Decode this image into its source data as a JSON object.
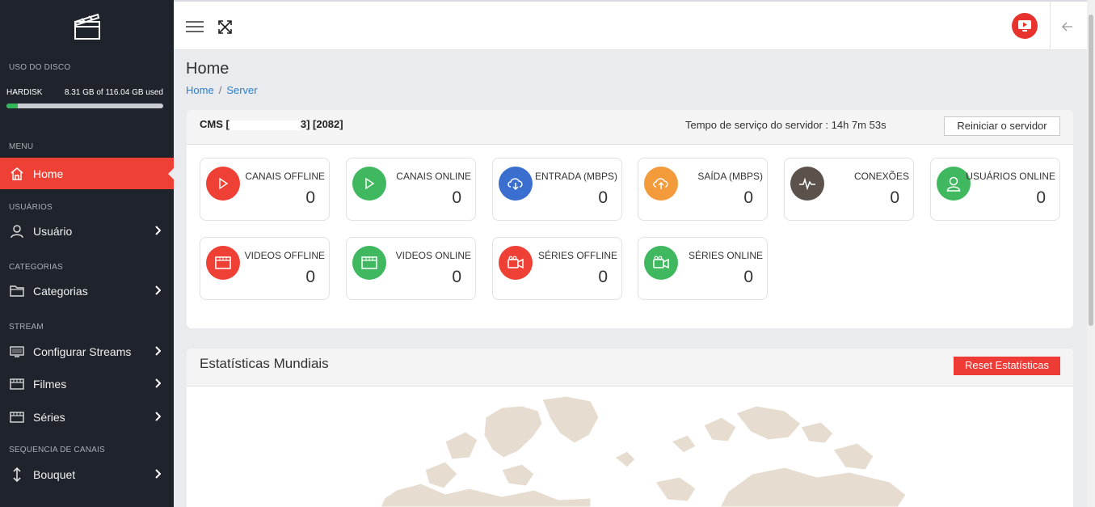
{
  "sidebar": {
    "disk_section": "USO DO DISCO",
    "disk_label": "HARDISK",
    "disk_used": "8.31 GB of 116.04 GB used",
    "disk_fraction": 0.0716,
    "menu_section": "MENU",
    "home": "Home",
    "users_section": "USUÁRIOS",
    "user": "Usuário",
    "categories_section": "CATEGORIAS",
    "categories": "Categorias",
    "stream_section": "STREAM",
    "streams": "Configurar Streams",
    "films": "Filmes",
    "series": "Séries",
    "channels_section": "SEQUENCIA DE CANAIS",
    "bouquet": "Bouquet"
  },
  "header": {
    "title": "Home",
    "crumb_home": "Home",
    "crumb_server": "Server"
  },
  "server": {
    "cms_label": "CMS [",
    "cms_hidden": "",
    "cms_port": "3] [2082]",
    "uptime": "Tempo de serviço do servidor : 14h 7m 53s",
    "restart": "Reiniciar o servidor"
  },
  "stats": [
    {
      "label": "CANAIS OFFLINE",
      "value": "0"
    },
    {
      "label": "CANAIS ONLINE",
      "value": "0"
    },
    {
      "label": "ENTRADA (MBPS)",
      "value": "0"
    },
    {
      "label": "SAÍDA (MBPS)",
      "value": "0"
    },
    {
      "label": "CONEXÕES",
      "value": "0"
    },
    {
      "label": "USUÁRIOS ONLINE",
      "value": "0"
    },
    {
      "label": "VIDEOS OFFLINE",
      "value": "0"
    },
    {
      "label": "VIDEOS ONLINE",
      "value": "0"
    },
    {
      "label": "SÉRIES OFFLINE",
      "value": "0"
    },
    {
      "label": "SÉRIES ONLINE",
      "value": "0"
    }
  ],
  "world": {
    "title": "Estatísticas Mundiais",
    "reset": "Reset Estatísticas"
  },
  "colors": {
    "red": "#ef4036",
    "green": "#3fb85f",
    "blue": "#3a6fd0",
    "orange": "#f39a3b",
    "brown": "#5b524c",
    "sidebar": "#1f232b",
    "link": "#2f80c9"
  },
  "icons": {
    "logo": "clapperboard-icon",
    "menu": "hamburger-icon",
    "fullscreen": "expand-icon",
    "youtube": "youtube-icon",
    "back": "arrow-left-icon"
  }
}
